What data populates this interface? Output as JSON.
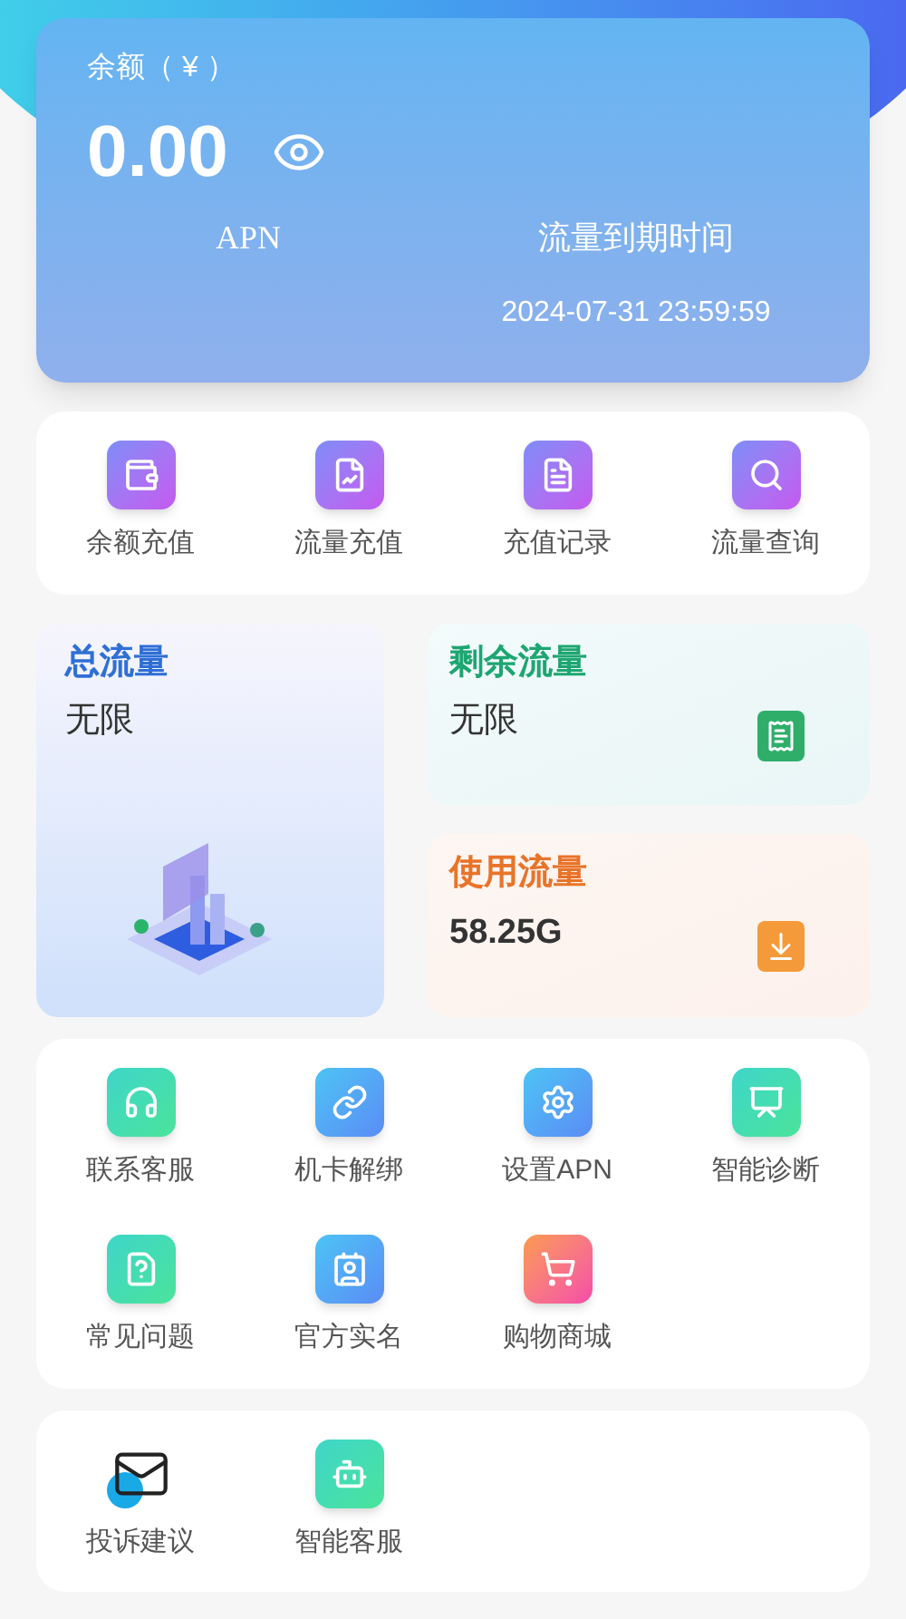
{
  "balance": {
    "label": "余额（ ¥ ）",
    "amount": "0.00",
    "apn_label": "APN",
    "expiry_label": "流量到期时间",
    "expiry": "2024-07-31 23:59:59"
  },
  "quick_actions": [
    {
      "label": "余额充值"
    },
    {
      "label": "流量充值"
    },
    {
      "label": "充值记录"
    },
    {
      "label": "流量查询"
    }
  ],
  "data_stats": [
    {
      "title": "总流量",
      "value": "无限",
      "color": "#2f6fd6"
    },
    {
      "title": "剩余流量",
      "value": "无限",
      "color": "#1ea672"
    },
    {
      "title": "使用流量",
      "value": "58.25G",
      "color": "#e8742a"
    }
  ],
  "services": [
    {
      "label": "联系客服"
    },
    {
      "label": "机卡解绑"
    },
    {
      "label": "设置APN"
    },
    {
      "label": "智能诊断"
    },
    {
      "label": "常见问题"
    },
    {
      "label": "官方实名"
    },
    {
      "label": "购物商城"
    }
  ],
  "more_services": [
    {
      "label": "投诉建议"
    },
    {
      "label": "智能客服"
    }
  ]
}
